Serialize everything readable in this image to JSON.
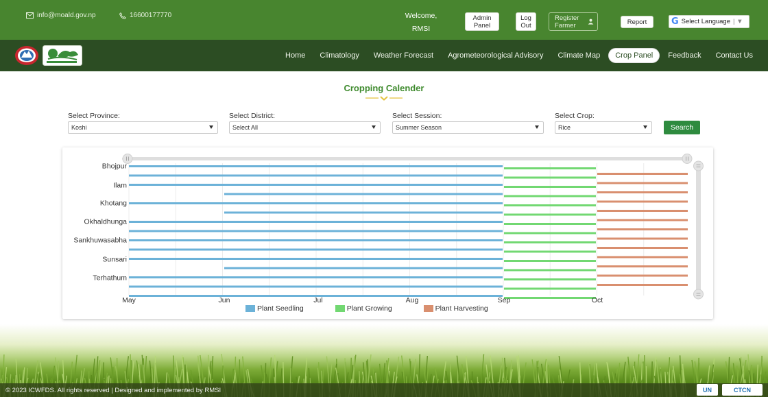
{
  "topbar": {
    "email": "info@moald.gov.np",
    "phone": "16600177770",
    "welcome_line1": "Welcome,",
    "welcome_line2": "RMSI",
    "admin_panel_label": "Admin Panel",
    "logout_label": "Log Out",
    "register_farmer_label": "Register Farmer",
    "report_label": "Report",
    "language_label": "Select Language",
    "icons": [
      "mail-icon",
      "phone-icon",
      "user-icon",
      "google-icon"
    ]
  },
  "nav": {
    "items": [
      {
        "label": "Home"
      },
      {
        "label": "Climatology"
      },
      {
        "label": "Weather Forecast"
      },
      {
        "label": "Agrometeorological Advisory"
      },
      {
        "label": "Climate Map"
      },
      {
        "label": "Crop Panel",
        "active": true
      },
      {
        "label": "Feedback"
      },
      {
        "label": "Contact Us"
      }
    ]
  },
  "page": {
    "title": "Cropping Calender"
  },
  "filters": {
    "province_label": "Select Province:",
    "province_value": "Koshi",
    "district_label": "Select District:",
    "district_value": "Select All",
    "session_label": "Select Session:",
    "session_value": "Summer Season",
    "crop_label": "Select Crop:",
    "crop_value": "Rice",
    "search_label": "Search"
  },
  "colors": {
    "topbar": "#48852f",
    "nav": "#2c4d23",
    "title": "#3e8a2d",
    "search_button": "#2e8b3f",
    "seedling": "#6cb2d8",
    "growing": "#72d872",
    "harvesting": "#d98f6f"
  },
  "chart_data": {
    "type": "gantt",
    "categories": [
      "Bhojpur",
      "Ilam",
      "Khotang",
      "Okhaldhunga",
      "Sankhuwasabha",
      "Sunsari",
      "Terhathum"
    ],
    "x_ticks": [
      "May",
      "Jun",
      "Jul",
      "Aug",
      "Sep",
      "Oct"
    ],
    "x_range": [
      "May",
      "mid-Nov"
    ],
    "series": [
      {
        "name": "Plant Seedling",
        "rows": [
          [
            "May",
            "Sep"
          ],
          [
            "May",
            "Sep"
          ],
          [
            "May",
            "Sep"
          ],
          [
            "mid-Jun",
            "Sep"
          ],
          [
            "May",
            "Sep"
          ],
          [
            "mid-Jun",
            "Sep"
          ],
          [
            "May",
            "Sep"
          ],
          [
            "May",
            "Sep"
          ],
          [
            "May",
            "Sep"
          ],
          [
            "May",
            "Sep"
          ],
          [
            "May",
            "Sep"
          ],
          [
            "mid-Jun",
            "Sep"
          ],
          [
            "May",
            "Sep"
          ],
          [
            "May",
            "Sep"
          ],
          [
            "May",
            "Sep"
          ]
        ]
      },
      {
        "name": "Plant Growing",
        "rows": [
          [
            "Sep",
            "end-Sep"
          ],
          [
            "Sep",
            "end-Sep"
          ],
          [
            "Sep",
            "end-Sep"
          ],
          [
            "Sep",
            "end-Sep"
          ],
          [
            "Sep",
            "end-Sep"
          ],
          [
            "Sep",
            "end-Sep"
          ],
          [
            "Sep",
            "end-Sep"
          ],
          [
            "Sep",
            "end-Sep"
          ],
          [
            "Sep",
            "end-Sep"
          ],
          [
            "Sep",
            "end-Sep"
          ],
          [
            "Sep",
            "end-Sep"
          ],
          [
            "Sep",
            "end-Sep"
          ],
          [
            "Sep",
            "end-Sep"
          ],
          [
            "Sep",
            "end-Sep"
          ],
          [
            "Sep",
            "end-Sep"
          ]
        ]
      },
      {
        "name": "Plant Harvesting",
        "rows": [
          [
            "end-Sep",
            "mid-Nov"
          ],
          [
            "end-Sep",
            "mid-Nov"
          ],
          [
            "end-Sep",
            "mid-Nov"
          ],
          [
            "end-Sep",
            "mid-Nov"
          ],
          [
            "end-Sep",
            "mid-Nov"
          ],
          [
            "end-Sep",
            "mid-Nov"
          ],
          [
            "end-Sep",
            "mid-Nov"
          ],
          [
            "end-Sep",
            "mid-Nov"
          ],
          [
            "end-Sep",
            "mid-Nov"
          ],
          [
            "end-Sep",
            "mid-Nov"
          ],
          [
            "end-Sep",
            "mid-Nov"
          ],
          [
            "end-Sep",
            "mid-Nov"
          ],
          [
            "end-Sep",
            "mid-Nov"
          ]
        ]
      }
    ],
    "legend": [
      "Plant Seedling",
      "Plant Growing",
      "Plant Harvesting"
    ],
    "legend_position": "bottom",
    "grid": "vertical"
  },
  "footer": {
    "copyright": "© 2023 ICWFDS. All rights reserved | Designed and implemented by RMSI",
    "partner1": "UN",
    "partner2": "CTCN"
  }
}
